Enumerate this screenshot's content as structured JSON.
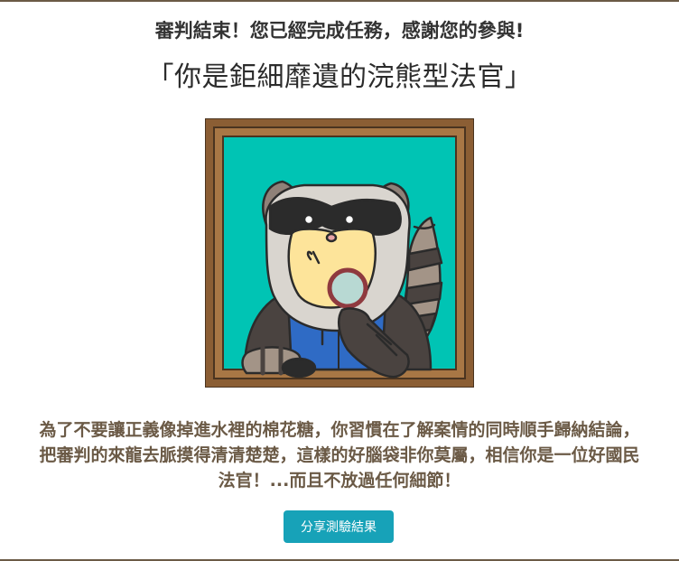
{
  "result": {
    "completion_message": "審判結束！您已經完成任務，感謝您的參與!",
    "title": "「你是鉅細靡遺的浣熊型法官」",
    "description": "為了不要讓正義像掉進水裡的棉花糖，你習慣在了解案情的同時順手歸納結論，把審判的來龍去脈摸得清清楚楚，這樣的好腦袋非你莫屬，相信你是一位好國民法官！...而且不放過任何細節！"
  },
  "portrait": {
    "icon": "raccoon-judge-with-magnifying-glass-illustration",
    "frame_color": "#8b5e34",
    "background_color": "#00c4b4"
  },
  "actions": {
    "share_label": "分享測驗結果"
  },
  "colors": {
    "button": "#17a2b8",
    "description_text": "#6b5a46",
    "border": "#6b5a46"
  }
}
